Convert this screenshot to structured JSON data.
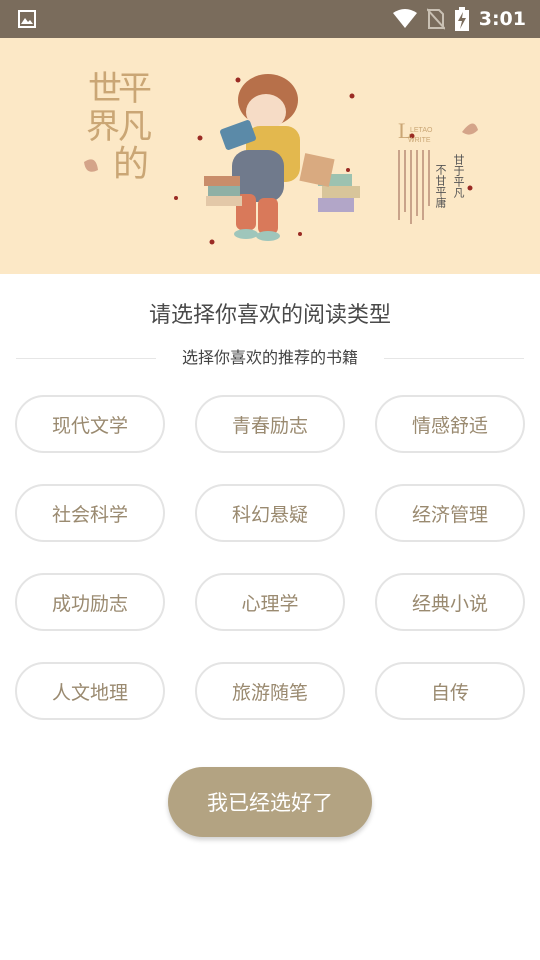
{
  "status_bar": {
    "time": "3:01",
    "icons": [
      "gallery-icon",
      "wifi-icon",
      "no-sim-icon",
      "battery-charging-icon"
    ]
  },
  "banner": {
    "left_text": [
      "世",
      "平",
      "界",
      "凡",
      "的"
    ],
    "right_logo": "LETAO",
    "right_sub": "WRITE",
    "right_vertical_1": "甘于平凡",
    "right_vertical_2": "不甘平庸"
  },
  "main_title": "请选择你喜欢的阅读类型",
  "sub_title": "选择你喜欢的推荐的书籍",
  "categories": [
    "现代文学",
    "青春励志",
    "情感舒适",
    "社会科学",
    "科幻悬疑",
    "经济管理",
    "成功励志",
    "心理学",
    "经典小说",
    "人文地理",
    "旅游随笔",
    "自传"
  ],
  "confirm_label": "我已经选好了",
  "colors": {
    "status_bar": "#7a6c5c",
    "banner_bg": "#fce8c6",
    "category_text": "#9a8a70",
    "category_border": "#e4e4e4",
    "confirm_bg": "#b3a382"
  }
}
